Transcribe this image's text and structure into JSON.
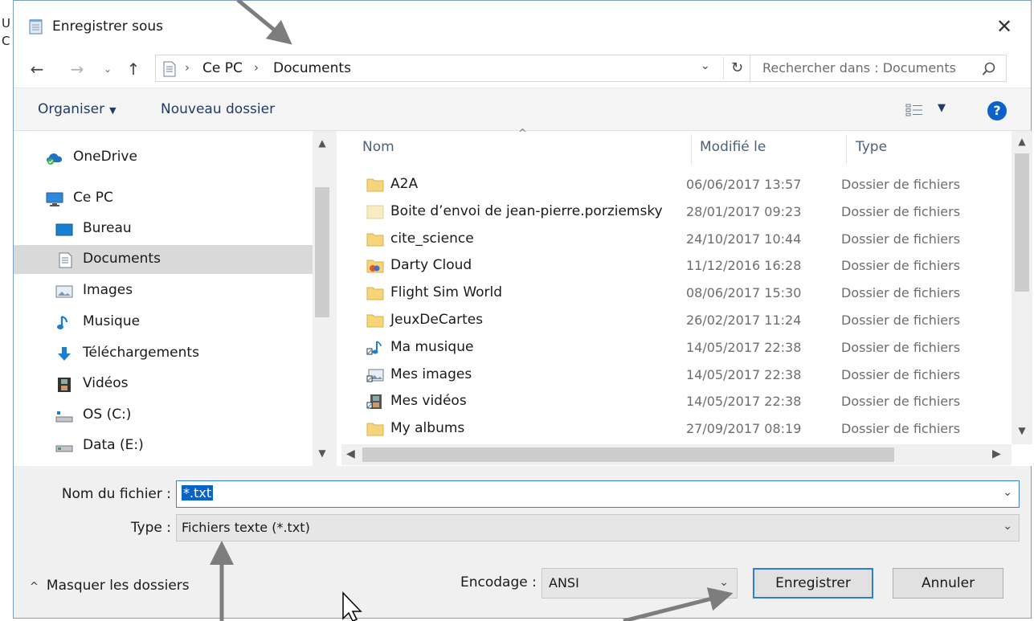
{
  "background_text": {
    "line1": "U",
    "line2": "C"
  },
  "window": {
    "title": "Enregistrer sous",
    "close_symbol": "✕"
  },
  "address_bar": {
    "crumbs": [
      "Ce PC",
      "Documents"
    ],
    "search_placeholder": "Rechercher dans : Documents"
  },
  "toolbar": {
    "organize": "Organiser",
    "new_folder": "Nouveau dossier"
  },
  "nav_pane": {
    "items": [
      {
        "label": "OneDrive",
        "icon": "onedrive-icon"
      },
      {
        "label": "Ce PC",
        "icon": "computer-icon"
      },
      {
        "label": "Bureau",
        "icon": "desktop-icon"
      },
      {
        "label": "Documents",
        "icon": "documents-icon",
        "selected": true
      },
      {
        "label": "Images",
        "icon": "pictures-icon"
      },
      {
        "label": "Musique",
        "icon": "music-icon"
      },
      {
        "label": "Téléchargements",
        "icon": "download-icon"
      },
      {
        "label": "Vidéos",
        "icon": "videos-icon"
      },
      {
        "label": "OS (C:)",
        "icon": "drive-icon"
      },
      {
        "label": "Data (E:)",
        "icon": "drive-icon"
      }
    ]
  },
  "file_list": {
    "columns": {
      "name": "Nom",
      "modified": "Modifié le",
      "type": "Type"
    },
    "rows": [
      {
        "name": "A2A",
        "date": "06/06/2017 13:57",
        "type": "Dossier de fichiers",
        "icon": "folder-icon"
      },
      {
        "name": "Boite d’envoi de jean-pierre.porziemsky",
        "date": "28/01/2017 09:23",
        "type": "Dossier de fichiers",
        "icon": "folder-light-icon"
      },
      {
        "name": "cite_science",
        "date": "24/10/2017 10:44",
        "type": "Dossier de fichiers",
        "icon": "folder-icon"
      },
      {
        "name": "Darty Cloud",
        "date": "11/12/2016 16:28",
        "type": "Dossier de fichiers",
        "icon": "cloud-folder-icon"
      },
      {
        "name": "Flight Sim World",
        "date": "08/06/2017 15:30",
        "type": "Dossier de fichiers",
        "icon": "folder-icon"
      },
      {
        "name": "JeuxDeCartes",
        "date": "26/02/2017 11:24",
        "type": "Dossier de fichiers",
        "icon": "folder-icon"
      },
      {
        "name": "Ma musique",
        "date": "14/05/2017 22:38",
        "type": "Dossier de fichiers",
        "icon": "music-shortcut-icon"
      },
      {
        "name": "Mes images",
        "date": "14/05/2017 22:38",
        "type": "Dossier de fichiers",
        "icon": "pictures-shortcut-icon"
      },
      {
        "name": "Mes vidéos",
        "date": "14/05/2017 22:38",
        "type": "Dossier de fichiers",
        "icon": "videos-shortcut-icon"
      },
      {
        "name": "My albums",
        "date": "27/09/2017 08:19",
        "type": "Dossier de fichiers",
        "icon": "folder-icon"
      }
    ]
  },
  "form": {
    "filename_label": "Nom du fichier :",
    "filename_value": "*.txt",
    "type_label": "Type :",
    "type_value": "Fichiers texte (*.txt)"
  },
  "footer": {
    "hide_folders": "Masquer les dossiers",
    "encoding_label": "Encodage :",
    "encoding_value": "ANSI",
    "save": "Enregistrer",
    "cancel": "Annuler"
  },
  "colors": {
    "accent": "#0a64c8",
    "folder": "#f6d47a",
    "annotation_arrow": "#7d7d7d"
  }
}
